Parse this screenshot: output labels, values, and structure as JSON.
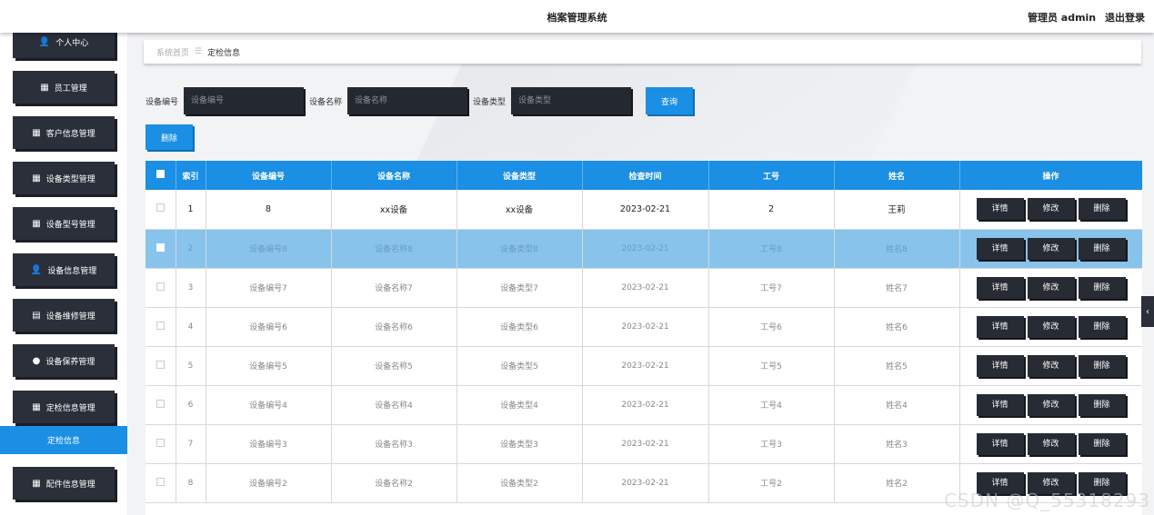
{
  "header": {
    "title": "档案管理系统",
    "user_label": "管理员 admin",
    "logout_label": "退出登录"
  },
  "sidebar": {
    "items": [
      {
        "label": "个人中心",
        "icon": "user-icon",
        "glyph": "👤"
      },
      {
        "label": "员工管理",
        "icon": "grid-icon",
        "glyph": "▦"
      },
      {
        "label": "客户信息管理",
        "icon": "grid-icon",
        "glyph": "▦"
      },
      {
        "label": "设备类型管理",
        "icon": "grid-icon",
        "glyph": "▦"
      },
      {
        "label": "设备型号管理",
        "icon": "grid-icon",
        "glyph": "▦"
      },
      {
        "label": "设备信息管理",
        "icon": "user-icon",
        "glyph": "👤"
      },
      {
        "label": "设备维修管理",
        "icon": "clipboard-icon",
        "glyph": "▤"
      },
      {
        "label": "设备保养管理",
        "icon": "location-pin-icon",
        "glyph": "●"
      },
      {
        "label": "定检信息管理",
        "icon": "grid-icon",
        "glyph": "▦"
      },
      {
        "label": "配件信息管理",
        "icon": "grid-icon",
        "glyph": "▦"
      }
    ],
    "active_sub": "定检信息"
  },
  "breadcrumb": {
    "home": "系统首页",
    "separator": "☰",
    "current": "定检信息"
  },
  "search": {
    "fields": [
      {
        "label": "设备编号",
        "placeholder": "设备编号"
      },
      {
        "label": "设备名称",
        "placeholder": "设备名称"
      },
      {
        "label": "设备类型",
        "placeholder": "设备类型"
      }
    ],
    "query_label": "查询",
    "delete_label": "删除"
  },
  "table": {
    "headers": [
      "",
      "索引",
      "设备编号",
      "设备名称",
      "设备类型",
      "检查时间",
      "工号",
      "姓名",
      "操作"
    ],
    "rows": [
      [
        "1",
        "8",
        "xx设备",
        "xx设备",
        "2023-02-21",
        "2",
        "王莉"
      ],
      [
        "2",
        "设备编号8",
        "设备名称8",
        "设备类型8",
        "2023-02-21",
        "工号8",
        "姓名8"
      ],
      [
        "3",
        "设备编号7",
        "设备名称7",
        "设备类型7",
        "2023-02-21",
        "工号7",
        "姓名7"
      ],
      [
        "4",
        "设备编号6",
        "设备名称6",
        "设备类型6",
        "2023-02-21",
        "工号6",
        "姓名6"
      ],
      [
        "5",
        "设备编号5",
        "设备名称5",
        "设备类型5",
        "2023-02-21",
        "工号5",
        "姓名5"
      ],
      [
        "6",
        "设备编号4",
        "设备名称4",
        "设备类型4",
        "2023-02-21",
        "工号4",
        "姓名4"
      ],
      [
        "7",
        "设备编号3",
        "设备名称3",
        "设备类型3",
        "2023-02-21",
        "工号3",
        "姓名3"
      ],
      [
        "8",
        "设备编号2",
        "设备名称2",
        "设备类型2",
        "2023-02-21",
        "工号2",
        "姓名2"
      ]
    ],
    "actions": [
      "详情",
      "修改",
      "删除"
    ]
  },
  "watermark": "CSDN @Q_55318293",
  "colors": {
    "accent": "#1a8fe3",
    "dark_button": "#262b34",
    "selected_row": "#88c3ec"
  }
}
